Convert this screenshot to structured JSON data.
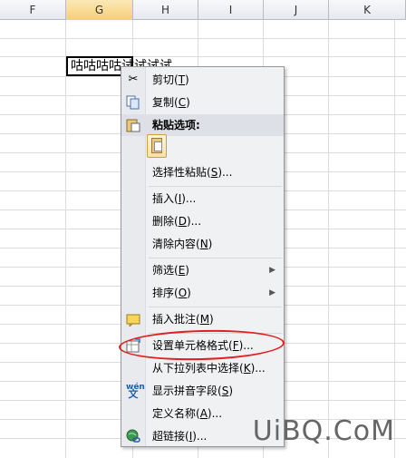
{
  "columns": [
    "F",
    "G",
    "H",
    "I",
    "J",
    "K"
  ],
  "selected_column": "G",
  "cell": {
    "value": "咕咕咕咕试试试试"
  },
  "menu": {
    "cut": {
      "label": "剪切(",
      "key": "T",
      "tail": ")"
    },
    "copy": {
      "label": "复制(",
      "key": "C",
      "tail": ")"
    },
    "paste_options": {
      "label": "粘贴选项:"
    },
    "paste_special": {
      "label": "选择性粘贴(",
      "key": "S",
      "tail": ")..."
    },
    "insert": {
      "label": "插入(",
      "key": "I",
      "tail": ")..."
    },
    "delete": {
      "label": "删除(",
      "key": "D",
      "tail": ")..."
    },
    "clear": {
      "label": "清除内容(",
      "key": "N",
      "tail": ")"
    },
    "filter": {
      "label": "筛选(",
      "key": "E",
      "tail": ")"
    },
    "sort": {
      "label": "排序(",
      "key": "O",
      "tail": ")"
    },
    "insert_comment": {
      "label": "插入批注(",
      "key": "M",
      "tail": ")"
    },
    "format_cells": {
      "label": "设置单元格格式(",
      "key": "F",
      "tail": ")..."
    },
    "pick_list": {
      "label": "从下拉列表中选择(",
      "key": "K",
      "tail": ")..."
    },
    "phonetic": {
      "label": "显示拼音字段(",
      "key": "S",
      "tail": ")"
    },
    "define_name": {
      "label": "定义名称(",
      "key": "A",
      "tail": ")..."
    },
    "hyperlink": {
      "label": "超链接(",
      "key": "I",
      "tail": ")..."
    }
  },
  "watermark": "UiBQ.CoM",
  "colors": {
    "annotation": "#e02020",
    "selected_header": "#f5cf76"
  }
}
